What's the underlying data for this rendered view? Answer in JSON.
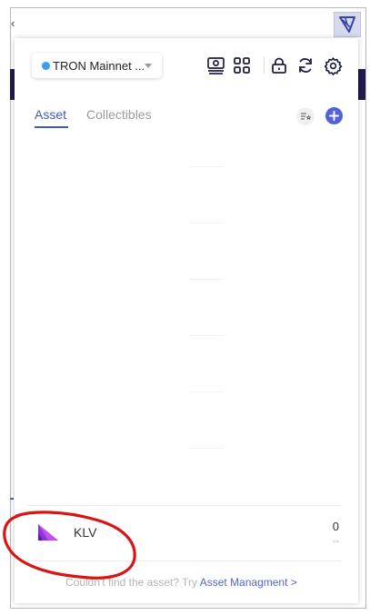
{
  "network": {
    "label": "TRON Mainnet ...",
    "status_color": "#3a9dee"
  },
  "toolbar": {
    "icons": [
      "wallet-stack-icon",
      "grid-icon",
      "lock-icon",
      "refresh-icon",
      "settings-icon"
    ]
  },
  "tabs": [
    {
      "label": "Asset",
      "active": true
    },
    {
      "label": "Collectibles",
      "active": false
    }
  ],
  "assets": [
    {
      "name": "KLV",
      "balance": "0",
      "value": "--"
    }
  ],
  "footer": {
    "text": "Couldn't find the asset? Try ",
    "link": "Asset Managment >"
  },
  "colors": {
    "accent": "#3d56c4",
    "add_button": "#5063d8",
    "icon": "#1f1f46",
    "annotation": "#d71515"
  }
}
